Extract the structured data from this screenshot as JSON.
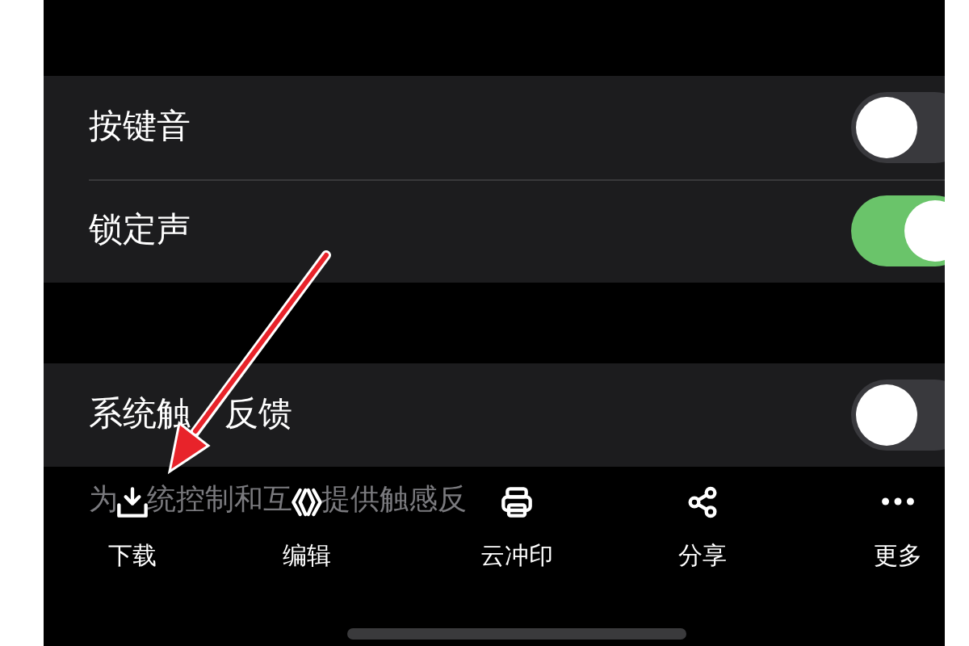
{
  "groups": [
    {
      "rows": [
        {
          "label_parts": [
            "按键音"
          ],
          "on": false
        },
        {
          "label_parts": [
            "锁定声"
          ],
          "on": true
        }
      ]
    },
    {
      "rows": [
        {
          "label_parts": [
            "系统触",
            "反馈"
          ],
          "on": false
        }
      ],
      "footer_parts": [
        "为",
        "统控制和互",
        "提供触感反"
      ]
    }
  ],
  "toolbar": [
    {
      "label": "下载",
      "kind": "download"
    },
    {
      "label": "编辑",
      "kind": "edit"
    },
    {
      "label": "云冲印",
      "kind": "print"
    },
    {
      "label": "分享",
      "kind": "share"
    },
    {
      "label": "更多",
      "kind": "more"
    }
  ]
}
